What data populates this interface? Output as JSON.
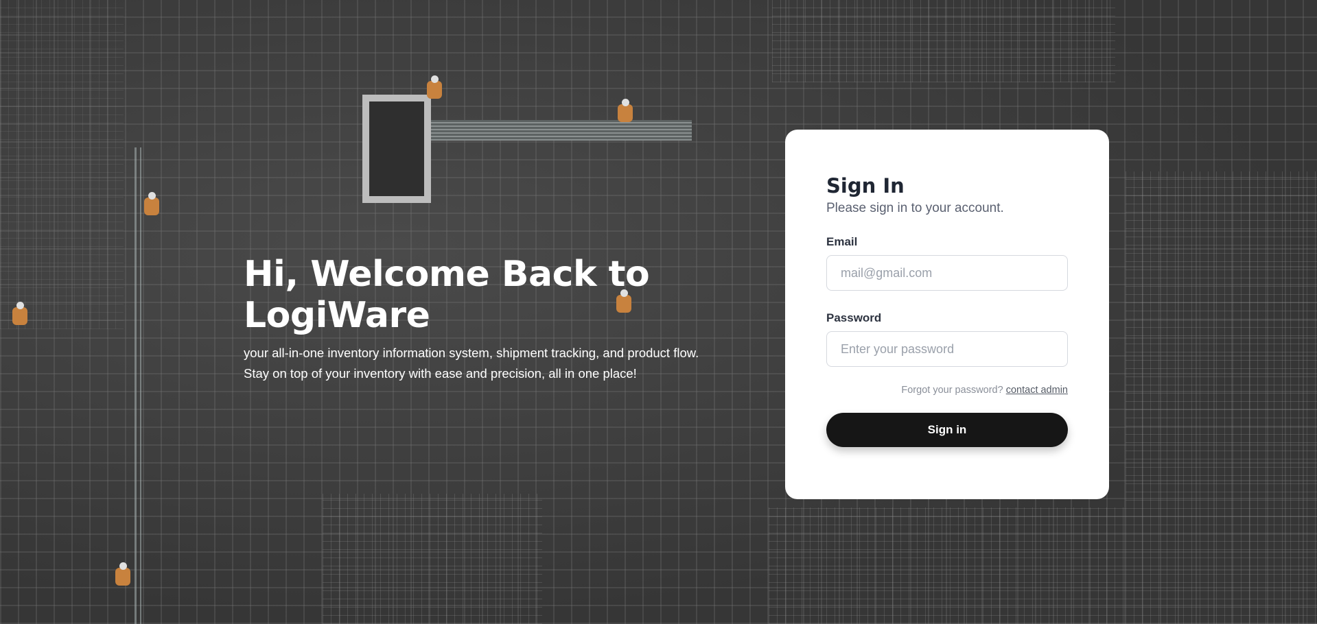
{
  "hero": {
    "title": "Hi, Welcome Back to LogiWare",
    "subtitle": "your all-in-one inventory information system, shipment tracking, and product flow. Stay on top of your inventory with ease and precision, all in one place!"
  },
  "signin": {
    "title": "Sign In",
    "subtitle": "Please sign in to your account.",
    "email_label": "Email",
    "email_placeholder": "mail@gmail.com",
    "email_value": "",
    "password_label": "Password",
    "password_placeholder": "Enter your password",
    "password_value": "",
    "forgot_text": "Forgot your password?",
    "contact_link": "contact admin",
    "button_label": "Sign in"
  },
  "colors": {
    "button_bg": "#161616",
    "card_bg": "#ffffff",
    "hero_text": "#ffffff"
  }
}
